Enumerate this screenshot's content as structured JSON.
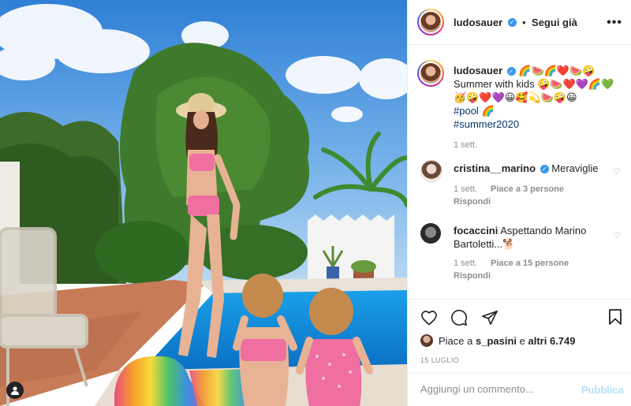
{
  "post": {
    "username": "ludosauer",
    "follow_status": "Segui già",
    "separator": "•",
    "more_label": "•••",
    "caption": {
      "emoji_line": "🌈🍉🌈❤️🍉🤪",
      "line2": "Summer with kids 🤪🍉❤️💜🌈💚",
      "line3": "🥳🤪❤️💜😀🥰💫🍉🤪😀",
      "hashtag1": "#pool",
      "hashtag1_emoji": "🌈",
      "hashtag2": "#summer2020",
      "time": "1 sett."
    },
    "comments": [
      {
        "username": "cristina__marino",
        "verified": true,
        "text": "Meraviglie",
        "time": "1 sett.",
        "likes": "Piace a 3 persone",
        "reply": "Rispondi"
      },
      {
        "username": "focaccini",
        "verified": false,
        "text": "Aspettando Marino Bartoletti...🐕",
        "time": "1 sett.",
        "likes": "Piace a 15 persone",
        "reply": "Rispondi"
      }
    ],
    "likes_prefix": "Piace a",
    "likes_user": "s_pasini",
    "likes_mid": "e",
    "likes_others": "altri 6.749",
    "date": "15 LUGLIO",
    "add_comment_placeholder": "Aggiungi un commento...",
    "publish_label": "Pubblica"
  },
  "icons": {
    "heart": "heart-icon",
    "comment": "comment-icon",
    "share": "paper-plane-icon",
    "save": "bookmark-icon",
    "verified": "verified-badge-icon",
    "user_tag": "user-tag-icon"
  },
  "colors": {
    "verified_blue": "#3897f0",
    "publish_disabled": "#b2dffc",
    "hashtag": "#00376b",
    "muted": "#8e8e8e"
  }
}
